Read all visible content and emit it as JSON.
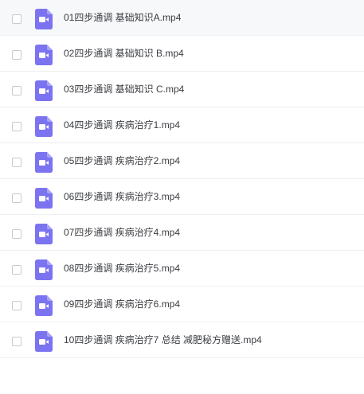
{
  "colors": {
    "video_icon": "#7B73F0",
    "row_divider": "#eeeff2",
    "text": "#3b3d42"
  },
  "file_icon_name": "video-file-icon",
  "files": [
    {
      "name": "01四步通调 基础知识A.mp4"
    },
    {
      "name": "02四步通调 基础知识 B.mp4"
    },
    {
      "name": "03四步通调 基础知识 C.mp4"
    },
    {
      "name": "04四步通调 疾病治疗1.mp4"
    },
    {
      "name": "05四步通调 疾病治疗2.mp4"
    },
    {
      "name": "06四步通调 疾病治疗3.mp4"
    },
    {
      "name": "07四步通调 疾病治疗4.mp4"
    },
    {
      "name": "08四步通调 疾病治疗5.mp4"
    },
    {
      "name": "09四步通调 疾病治疗6.mp4"
    },
    {
      "name": "10四步通调 疾病治疗7 总结 减肥秘方赠送.mp4"
    }
  ]
}
